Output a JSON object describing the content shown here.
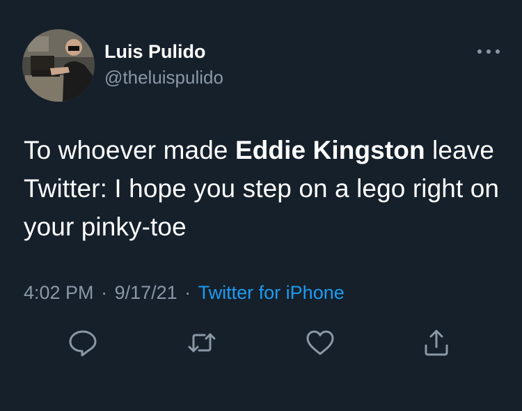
{
  "author": {
    "display_name": "Luis Pulido",
    "handle": "@theluispulido"
  },
  "tweet": {
    "text_before": "To whoever made ",
    "text_bold": "Eddie Kingston",
    "text_after": " leave Twitter: I hope you step on a lego right on your pinky-toe",
    "time": "4:02 PM",
    "date": "9/17/21",
    "source": "Twitter for iPhone"
  },
  "actions": [
    "reply-icon",
    "retweet-icon",
    "like-icon",
    "share-icon"
  ],
  "colors": {
    "background": "#15202b",
    "text": "#ffffff",
    "secondary": "#8b98a5",
    "link": "#1d9bf0"
  }
}
